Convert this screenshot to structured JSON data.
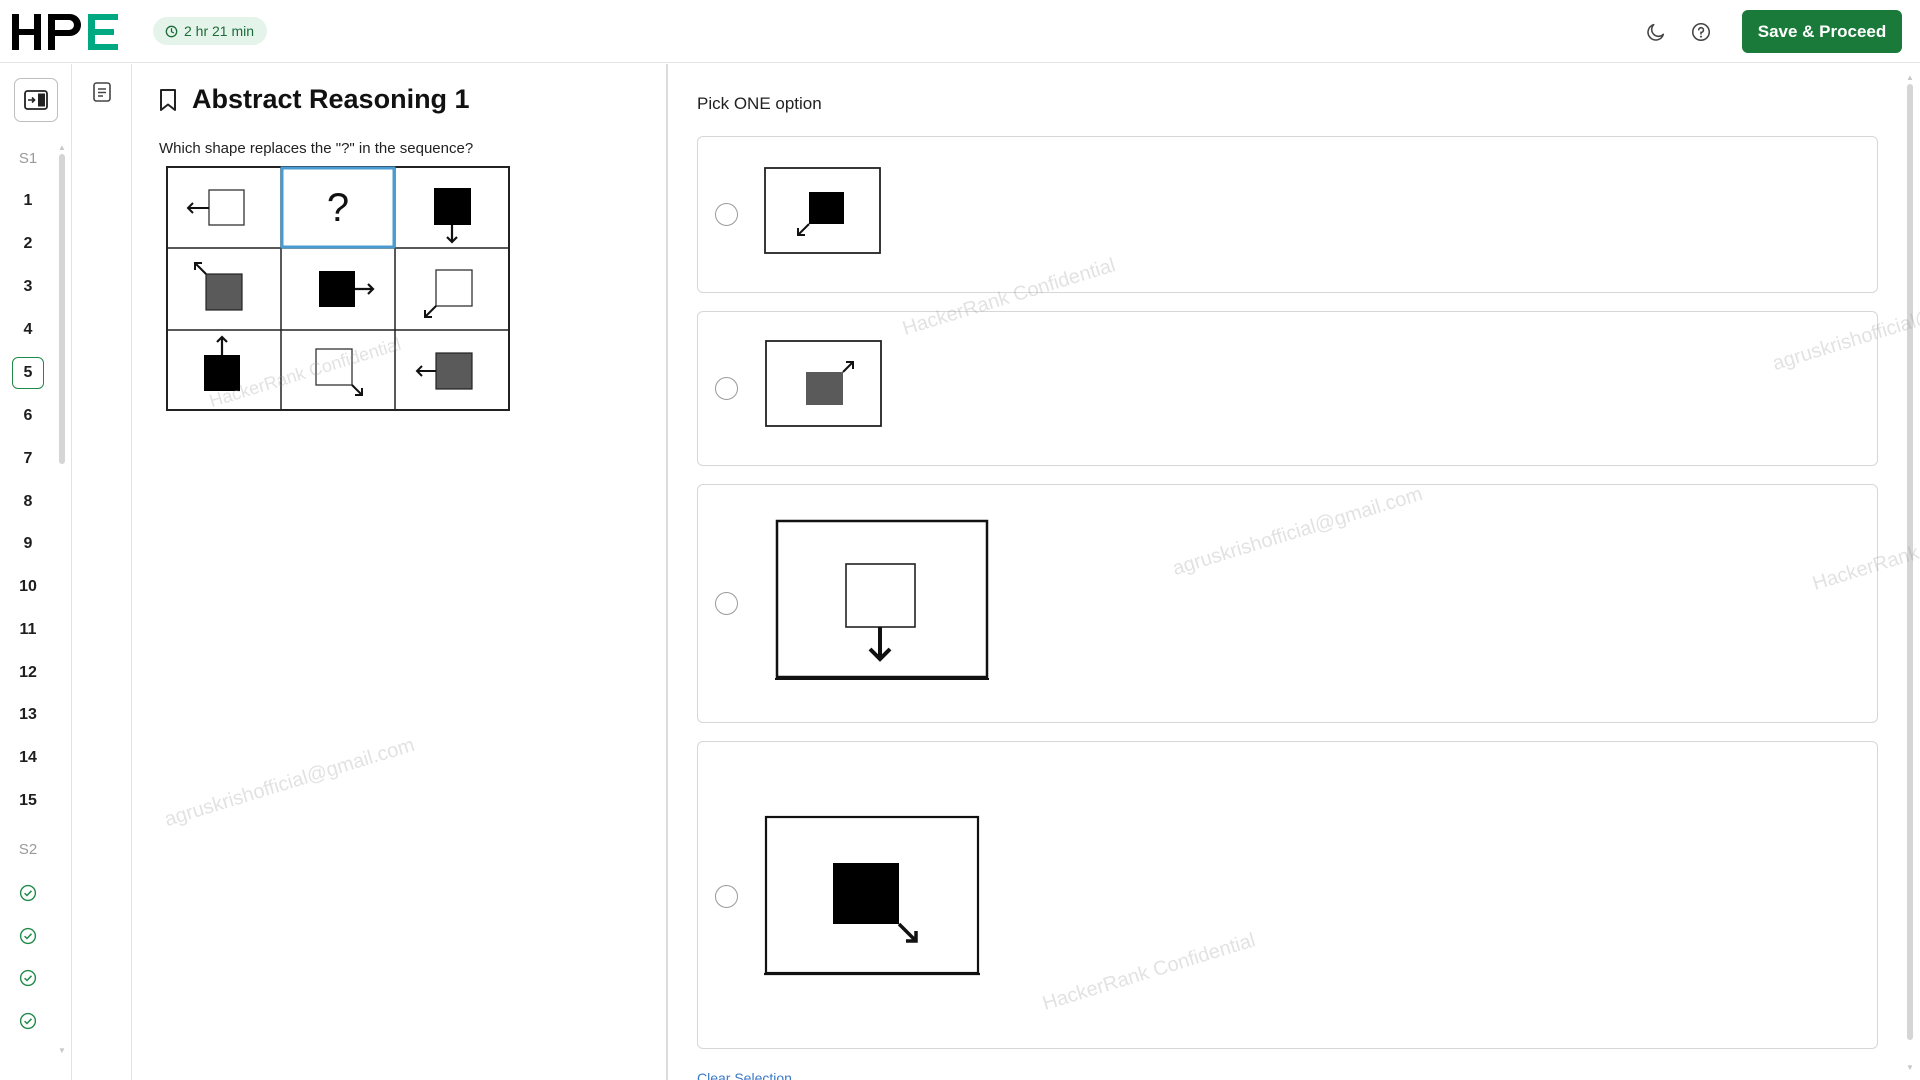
{
  "header": {
    "logo_text": "HPE",
    "timer": "2 hr 21 min",
    "save_label": "Save & Proceed",
    "icons": [
      "clock-icon",
      "moon-icon",
      "help-icon"
    ]
  },
  "nav": {
    "sections": [
      {
        "label": "S1",
        "items": [
          "1",
          "2",
          "3",
          "4",
          "5",
          "6",
          "7",
          "8",
          "9",
          "10",
          "11",
          "12",
          "13",
          "14",
          "15"
        ],
        "current": "5"
      },
      {
        "label": "S2",
        "completed_count_visible": 4
      }
    ]
  },
  "question": {
    "title": "Abstract Reasoning 1",
    "prompt": "Which shape replaces the \"?\" in the sequence?",
    "unknown_mark": "?"
  },
  "answer": {
    "pick_label": "Pick ONE option",
    "options": [
      {
        "id": "a",
        "icon": "black-square-arrow-down-left"
      },
      {
        "id": "b",
        "icon": "grey-square-arrow-up-right"
      },
      {
        "id": "c",
        "icon": "white-square-arrow-down"
      },
      {
        "id": "d",
        "icon": "black-square-arrow-down-right"
      }
    ],
    "clear_label": "Clear Selection"
  },
  "watermarks": {
    "company": "HackerRank Confidential",
    "email": "agruskrishofficial@gmail.com"
  },
  "colors": {
    "brand_green": "#1a7a3a",
    "logo_accent": "#01a982",
    "timer_bg": "#e5f4ea",
    "highlight_cell": "#4a9bd1"
  }
}
